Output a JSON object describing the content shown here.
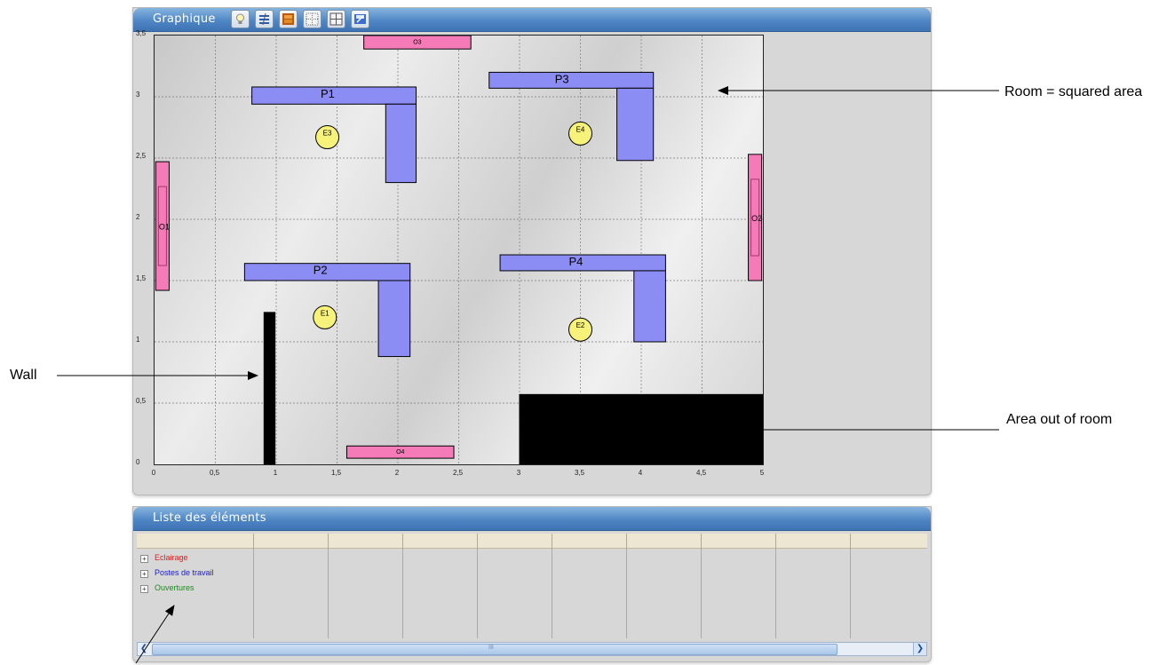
{
  "graph_panel": {
    "title": "Graphique",
    "toolbar": [
      "bulb-icon",
      "layers-icon",
      "window-icon",
      "grid-points-icon",
      "grid-icon",
      "save-icon"
    ]
  },
  "floor_plan": {
    "x_ticks": [
      "0",
      "0,5",
      "1",
      "1,5",
      "2",
      "2,5",
      "3",
      "3,5",
      "4",
      "4,5",
      "5"
    ],
    "y_ticks": [
      "0",
      "0,5",
      "1",
      "1,5",
      "2",
      "2,5",
      "3",
      "3,5"
    ],
    "x_range": [
      0,
      5
    ],
    "y_range": [
      0,
      3.5
    ],
    "grid": true,
    "workstations": [
      {
        "label": "P1",
        "bar": [
          0.8,
          2.94,
          2.15,
          3.08
        ],
        "leg": [
          1.9,
          2.3,
          2.15,
          2.94
        ]
      },
      {
        "label": "P2",
        "bar": [
          0.74,
          1.5,
          2.1,
          1.64
        ],
        "leg": [
          1.84,
          0.88,
          2.1,
          1.5
        ]
      },
      {
        "label": "P3",
        "bar": [
          2.75,
          3.07,
          4.1,
          3.2
        ],
        "leg": [
          3.8,
          2.48,
          4.1,
          3.07
        ]
      },
      {
        "label": "P4",
        "bar": [
          2.84,
          1.58,
          4.2,
          1.71
        ],
        "leg": [
          3.94,
          1.0,
          4.2,
          1.58
        ]
      }
    ],
    "lights": [
      {
        "label": "E3",
        "x": 1.42,
        "y": 2.67
      },
      {
        "label": "E4",
        "x": 3.5,
        "y": 2.7
      },
      {
        "label": "E1",
        "x": 1.4,
        "y": 1.2
      },
      {
        "label": "E2",
        "x": 3.5,
        "y": 1.1
      }
    ],
    "openings": [
      {
        "label": "O3",
        "rect": [
          1.72,
          3.39,
          2.6,
          3.5
        ]
      },
      {
        "label": "O4",
        "rect": [
          1.58,
          0.05,
          2.46,
          0.15
        ]
      },
      {
        "label": "O1",
        "rect": [
          0.01,
          1.42,
          0.12,
          2.47
        ]
      },
      {
        "label": "O2",
        "rect": [
          4.88,
          1.5,
          4.99,
          2.53
        ]
      }
    ],
    "wall": {
      "rect": [
        0.9,
        0,
        0.99,
        1.24
      ]
    },
    "outside_area": {
      "rect": [
        3.0,
        0,
        5.0,
        0.57
      ]
    },
    "colors": {
      "workstation": "#8c8cf5",
      "light": "#f7f27a",
      "opening": "#f57ab8",
      "wall": "#000000",
      "grid": "#7a7a7a"
    }
  },
  "list_panel": {
    "title": "Liste des éléments",
    "tree": [
      {
        "label": "Eclairage",
        "color": "#e01b1b"
      },
      {
        "label": "Postes de travail",
        "color": "#1a1acc"
      },
      {
        "label": "Ouvertures",
        "color": "#1a8c1a"
      }
    ],
    "scroll_grip": "III"
  },
  "annotations": {
    "room": "Room = squared area",
    "wall": "Wall",
    "outside": "Area out of room"
  }
}
